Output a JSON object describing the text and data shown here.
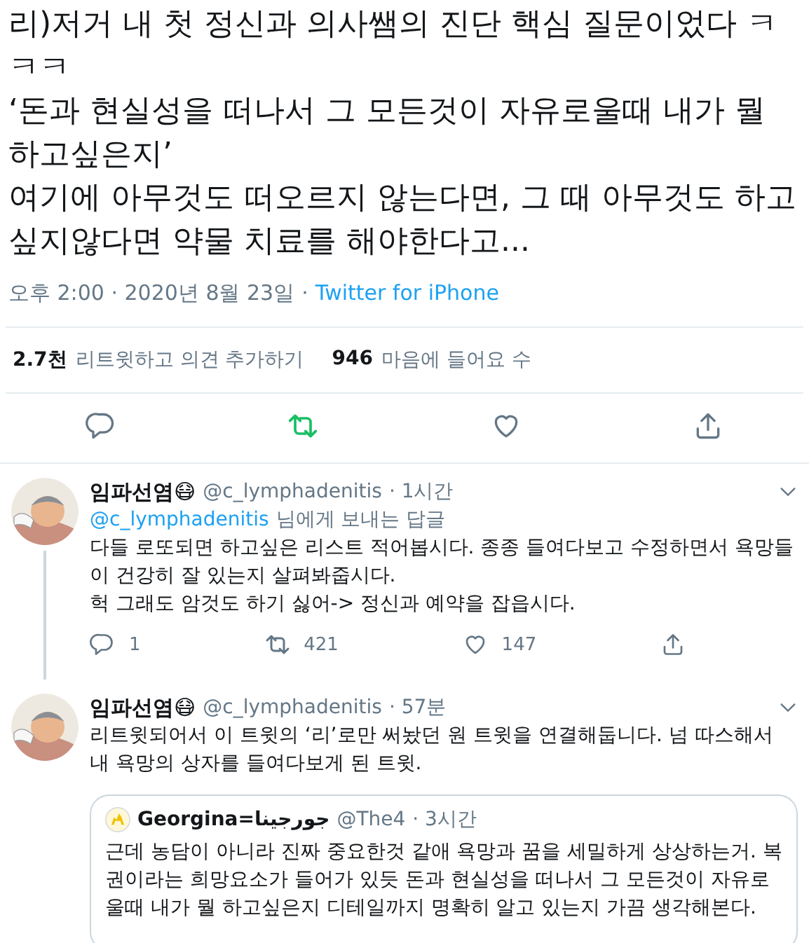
{
  "tweet": {
    "paragraphs": [
      "리)저거 내 첫 정신과 의사쌤의 진단 핵심 질문이었다 ㅋㅋㅋ",
      "‘돈과 현실성을 떠나서 그 모든것이 자유로울때 내가 뭘 하고싶은지’",
      "여기에 아무것도 떠오르지 않는다면, 그 때 아무것도 하고싶지않다면 약물 치료를 해야한다고..."
    ],
    "time": "오후 2:00 · 2020년 8월 23일",
    "separator": "·",
    "client": "Twitter for iPhone",
    "stats": [
      {
        "count": "2.7천",
        "label": "리트윗하고 의견 추가하기"
      },
      {
        "count": "946",
        "label": "마음에 들어요 수"
      }
    ],
    "actions": [
      {
        "kind": "reply",
        "active": false
      },
      {
        "kind": "retweet",
        "active": true
      },
      {
        "kind": "like",
        "active": false
      },
      {
        "kind": "share",
        "active": false
      }
    ]
  },
  "replies": [
    {
      "name": "임파선염😷",
      "handle": "@c_lymphadenitis",
      "time": "· 1시간",
      "reply_to": {
        "handle": "@c_lymphadenitis",
        "suffix": "님에게 보내는 답글"
      },
      "paragraphs": [
        "다들 로또되면 하고싶은 리스트 적어봅시다. 종종 들여다보고 수정하면서 욕망들이 건강히 잘 있는지 살펴봐줍시다.",
        "헉 그래도 암것도 하기 싫어-> 정신과 예약을 잡읍시다."
      ],
      "actions": [
        {
          "kind": "reply",
          "count": "1"
        },
        {
          "kind": "retweet",
          "count": "421"
        },
        {
          "kind": "like",
          "count": "147"
        },
        {
          "kind": "share"
        }
      ]
    },
    {
      "name": "임파선염😷",
      "handle": "@c_lymphadenitis",
      "time": "· 57분",
      "paragraphs": [
        "리트윗되어서 이 트윗의 ‘리’로만 써놨던 원 트윗을 연결해둡니다. 넘 따스해서 내 욕망의 상자를 들여다보게 된 트윗."
      ],
      "quote": {
        "name": "Georgina=جورجينا",
        "handle": "@The4",
        "time": "· 3시간",
        "text": "근데 농담이 아니라 진짜 중요한것 같애 욕망과 꿈을 세밀하게 상상하는거. 복권이라는 희망요소가 들어가 있듯 돈과 현실성을 떠나서 그 모든것이 자유로울때 내가 뭘 하고싶은지 디테일까지 명확히 알고 있는지 가끔 생각해본다."
      }
    }
  ]
}
